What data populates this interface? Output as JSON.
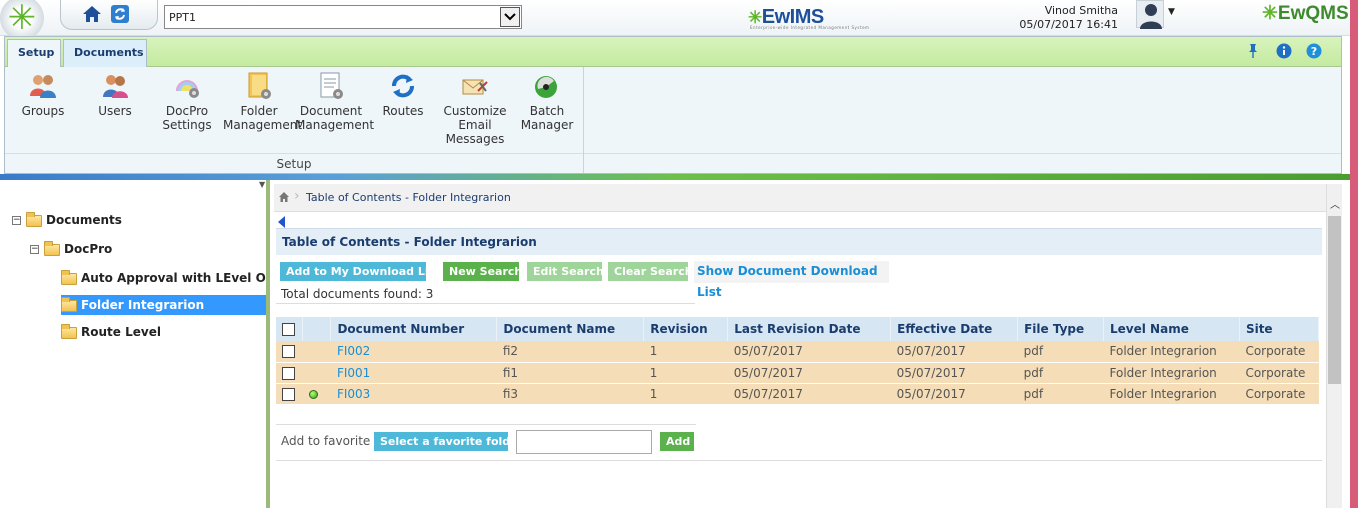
{
  "header": {
    "project": "PPT1",
    "brand_name": "EwIMS",
    "brand_tagline": "Enterprise-wide Integrated Management System",
    "user_name": "Vinod Smitha",
    "datetime": "05/07/2017 16:41",
    "qms_logo": "EwQMS"
  },
  "ribbon": {
    "tabs": [
      "Setup",
      "Documents"
    ],
    "buttons": {
      "groups": "Groups",
      "users": "Users",
      "docpro_1": "DocPro",
      "docpro_2": "Settings",
      "folder_1": "Folder",
      "folder_2": "Management",
      "document_1": "Document",
      "document_2": "Management",
      "routes": "Routes",
      "email_1": "Customize",
      "email_2": "Email",
      "email_3": "Messages",
      "batch_1": "Batch",
      "batch_2": "Manager"
    },
    "group_label": "Setup"
  },
  "tree": {
    "root": "Documents",
    "docpro": "DocPro",
    "item1": "Auto Approval with LEvel Ownw",
    "item2": "Folder Integrarion",
    "item3": "Route Level"
  },
  "main": {
    "breadcrumb": "Table of Contents - Folder Integrarion",
    "title": "Table of Contents - Folder Integrarion",
    "buttons": {
      "add_download": "Add to My Download List",
      "new_search": "New Search",
      "edit_search": "Edit Search",
      "clear_search": "Clear Search",
      "show_download": "Show Document Download List"
    },
    "total_docs": "Total documents found: 3",
    "columns": [
      "Document Number",
      "Document Name",
      "Revision",
      "Last Revision Date",
      "Effective Date",
      "File Type",
      "Level Name",
      "Site"
    ],
    "rows": [
      {
        "number": "FI002",
        "name": "fi2",
        "revision": "1",
        "last_revision": "05/07/2017",
        "effective": "05/07/2017",
        "file_type": "pdf",
        "level": "Folder Integrarion",
        "site": "Corporate"
      },
      {
        "number": "FI001",
        "name": "fi1",
        "revision": "1",
        "last_revision": "05/07/2017",
        "effective": "05/07/2017",
        "file_type": "pdf",
        "level": "Folder Integrarion",
        "site": "Corporate"
      },
      {
        "number": "FI003",
        "name": "fi3",
        "revision": "1",
        "last_revision": "05/07/2017",
        "effective": "05/07/2017",
        "file_type": "pdf",
        "level": "Folder Integrarion",
        "site": "Corporate"
      }
    ],
    "favorite": {
      "label": "Add to favorite",
      "select_button": "Select a favorite folder",
      "input_value": "",
      "add_button": "Add"
    }
  },
  "colors": {
    "accent_blue": "#1b3d6e",
    "link_blue": "#1a8fd6",
    "ribbon_green": "#c4eaa0",
    "row_highlight": "#f5ddb7",
    "selected_tree": "#3399ff"
  }
}
